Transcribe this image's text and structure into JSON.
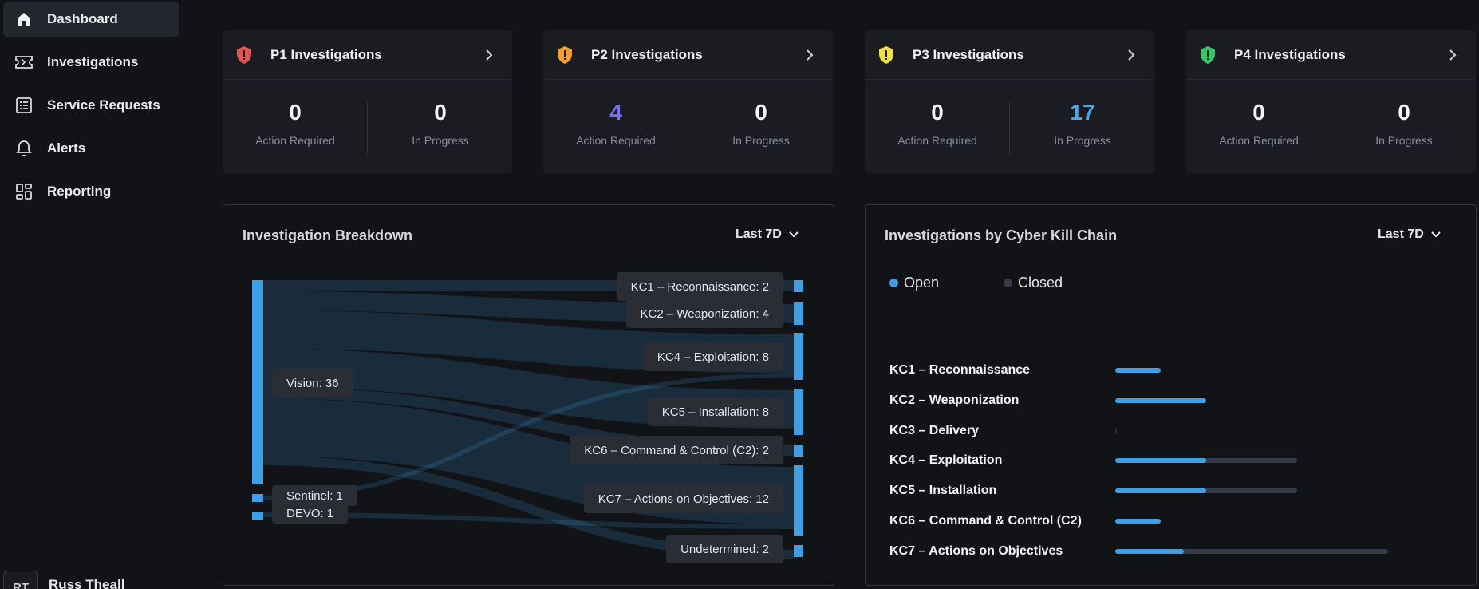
{
  "sidebar": {
    "items": [
      {
        "label": "Dashboard",
        "icon": "home-icon",
        "active": true
      },
      {
        "label": "Investigations",
        "icon": "ticket-icon",
        "active": false
      },
      {
        "label": "Service Requests",
        "icon": "list-icon",
        "active": false
      },
      {
        "label": "Alerts",
        "icon": "bell-icon",
        "active": false
      },
      {
        "label": "Reporting",
        "icon": "grid-icon",
        "active": false
      }
    ],
    "user": {
      "initials": "RT",
      "name": "Russ Theall"
    }
  },
  "cards": [
    {
      "title": "P1 Investigations",
      "shield_color": "#e05555",
      "action_required": "0",
      "in_progress": "0",
      "action_label": "Action Required",
      "progress_label": "In Progress"
    },
    {
      "title": "P2 Investigations",
      "shield_color": "#f0a030",
      "action_required": "4",
      "in_progress": "0",
      "action_label": "Action Required",
      "progress_label": "In Progress"
    },
    {
      "title": "P3 Investigations",
      "shield_color": "#f0e040",
      "action_required": "0",
      "in_progress": "17",
      "action_label": "Action Required",
      "progress_label": "In Progress"
    },
    {
      "title": "P4 Investigations",
      "shield_color": "#3fbf6a",
      "action_required": "0",
      "in_progress": "0",
      "action_label": "Action Required",
      "progress_label": "In Progress"
    }
  ],
  "breakdown": {
    "title": "Investigation Breakdown",
    "range": "Last 7D",
    "sources": [
      {
        "label": "Vision: 36"
      },
      {
        "label": "Sentinel: 1"
      },
      {
        "label": "DEVO: 1"
      }
    ],
    "targets": [
      {
        "label": "KC1 – Reconnaissance: 2"
      },
      {
        "label": "KC2 – Weaponization: 4"
      },
      {
        "label": "KC4 – Exploitation: 8"
      },
      {
        "label": "KC5 – Installation: 8"
      },
      {
        "label": "KC6 – Command & Control (C2): 2"
      },
      {
        "label": "KC7 – Actions on Objectives: 12"
      },
      {
        "label": "Undetermined: 2"
      }
    ],
    "node_color": "#3f9fe4"
  },
  "killchain": {
    "title": "Investigations by Cyber Kill Chain",
    "range": "Last 7D",
    "legend": [
      {
        "label": "Open",
        "color": "#3f9fe4"
      },
      {
        "label": "Closed",
        "color": "#3a3d48"
      }
    ],
    "rows": [
      {
        "label": "KC1 – Reconnaissance",
        "open": 2,
        "total": 2
      },
      {
        "label": "KC2 – Weaponization",
        "open": 4,
        "total": 4
      },
      {
        "label": "KC3 – Delivery",
        "open": 0,
        "total": 0
      },
      {
        "label": "KC4 – Exploitation",
        "open": 4,
        "total": 8
      },
      {
        "label": "KC5 – Installation",
        "open": 4,
        "total": 8
      },
      {
        "label": "KC6 – Command & Control (C2)",
        "open": 2,
        "total": 2
      },
      {
        "label": "KC7 – Actions on Objectives",
        "open": 3,
        "total": 12
      }
    ]
  }
}
